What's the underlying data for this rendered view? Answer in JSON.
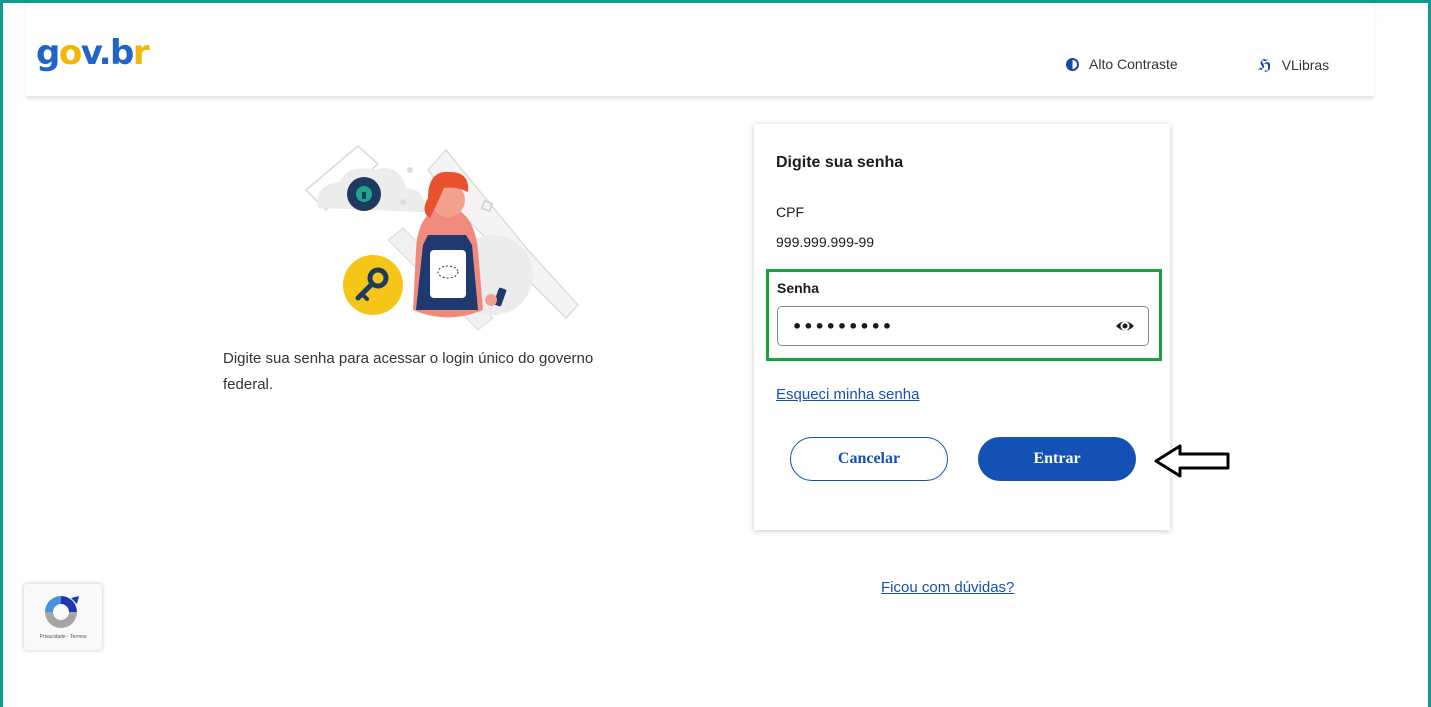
{
  "header": {
    "logo": {
      "g": "g",
      "o": "o",
      "v": "v",
      "dot": ".",
      "b": "b",
      "r": "r"
    },
    "contrast_label": "Alto Contraste",
    "vlibras_label": "VLibras"
  },
  "intro": {
    "text": "Digite sua senha para acessar o login único do governo federal."
  },
  "card": {
    "title": "Digite sua senha",
    "cpf_label": "CPF",
    "cpf_value": "999.999.999-99",
    "password_label": "Senha",
    "password_value": "•••••••••",
    "forgot_link": "Esqueci minha senha",
    "cancel_button": "Cancelar",
    "enter_button": "Entrar"
  },
  "help_link": "Ficou com dúvidas?",
  "recaptcha": {
    "text": "Privacidade - Termos"
  },
  "colors": {
    "primary": "#1351b4",
    "highlight_box": "#1aa33c",
    "frame": "#0f9a96",
    "logo_yellow": "#f2b705"
  },
  "icons": {
    "contrast": "contrast-icon",
    "vlibras": "vlibras-icon",
    "eye": "eye-icon",
    "arrow": "left-arrow-icon",
    "recaptcha": "recaptcha-icon"
  }
}
